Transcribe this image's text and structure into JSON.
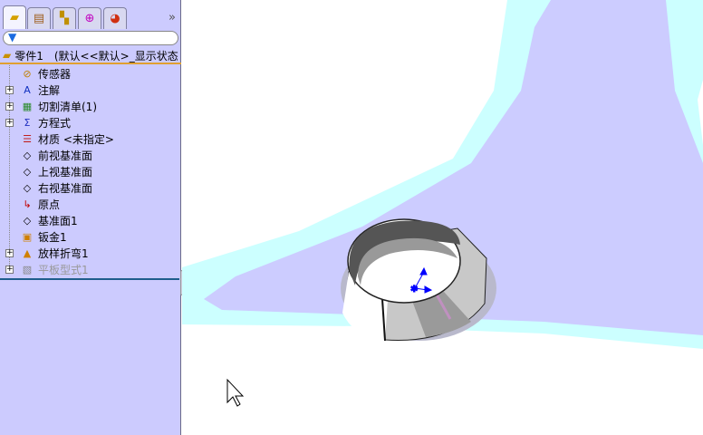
{
  "panel": {
    "tabs": [
      {
        "icon": "feature-manager-icon",
        "active": true
      },
      {
        "icon": "property-manager-icon"
      },
      {
        "icon": "configuration-manager-icon"
      },
      {
        "icon": "dimxpert-icon"
      },
      {
        "icon": "display-manager-icon"
      }
    ],
    "more": "»",
    "filter_icon": "filter-icon",
    "root": {
      "name": "零件1",
      "config": "(默认<<默认>_显示状态"
    },
    "items": [
      {
        "label": "传感器",
        "icon": "sensor-folder-icon",
        "expandable": false
      },
      {
        "label": "注解",
        "icon": "annotations-folder-icon",
        "expandable": true
      },
      {
        "label": "切割清单(1)",
        "icon": "cut-list-icon",
        "expandable": true
      },
      {
        "label": "方程式",
        "icon": "equations-folder-icon",
        "expandable": true
      },
      {
        "label": "材质 <未指定>",
        "icon": "material-icon",
        "expandable": false
      },
      {
        "label": "前视基准面",
        "icon": "plane-icon",
        "expandable": false
      },
      {
        "label": "上视基准面",
        "icon": "plane-icon",
        "expandable": false
      },
      {
        "label": "右视基准面",
        "icon": "plane-icon",
        "expandable": false
      },
      {
        "label": "原点",
        "icon": "origin-icon",
        "expandable": false
      },
      {
        "label": "基准面1",
        "icon": "plane-icon",
        "expandable": false
      },
      {
        "label": "钣金1",
        "icon": "sheet-metal-icon",
        "expandable": false
      },
      {
        "label": "放样折弯1",
        "icon": "lofted-bend-icon",
        "expandable": true
      },
      {
        "label": "平板型式1",
        "icon": "flat-pattern-icon",
        "expandable": true,
        "suppressed": true
      }
    ]
  },
  "colors": {
    "panel": "#cccbfe",
    "shape": "#ccccff",
    "halo": "#ccffff",
    "triad": "#0000ff"
  }
}
